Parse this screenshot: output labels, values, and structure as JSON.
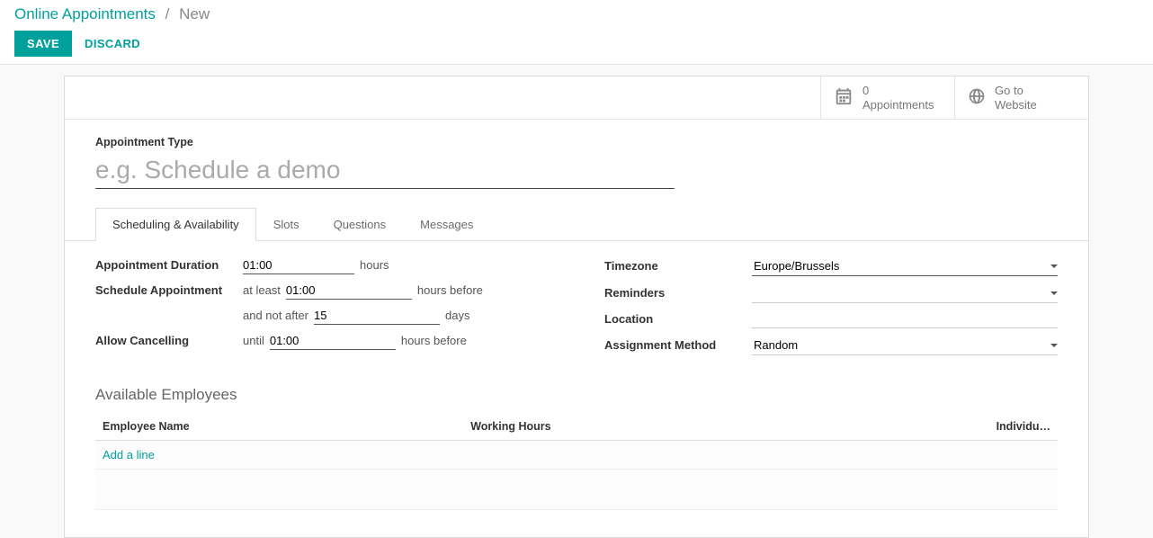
{
  "breadcrumb": {
    "root": "Online Appointments",
    "sep": "/",
    "current": "New"
  },
  "actions": {
    "save": "SAVE",
    "discard": "DISCARD"
  },
  "stat_buttons": {
    "appointments": {
      "count": "0",
      "label": "Appointments"
    },
    "website": {
      "line1": "Go to",
      "line2": "Website"
    }
  },
  "form": {
    "type_label": "Appointment Type",
    "type_value": "",
    "type_placeholder": "e.g. Schedule a demo",
    "tabs": [
      "Scheduling & Availability",
      "Slots",
      "Questions",
      "Messages"
    ],
    "left": {
      "duration_label": "Appointment Duration",
      "duration_value": "01:00",
      "duration_unit": "hours",
      "schedule_label": "Schedule Appointment",
      "schedule_atleast_prefix": "at least",
      "schedule_atleast_value": "01:00",
      "schedule_atleast_unit": "hours before",
      "schedule_notafter_prefix": "and not after",
      "schedule_notafter_value": "15",
      "schedule_notafter_unit": "days",
      "cancel_label": "Allow Cancelling",
      "cancel_prefix": "until",
      "cancel_value": "01:00",
      "cancel_unit": "hours before"
    },
    "right": {
      "timezone_label": "Timezone",
      "timezone_value": "Europe/Brussels",
      "reminders_label": "Reminders",
      "reminders_value": "",
      "location_label": "Location",
      "location_value": "",
      "assignment_label": "Assignment Method",
      "assignment_value": "Random"
    },
    "section_heading": "Available Employees",
    "table": {
      "col_employee": "Employee Name",
      "col_hours": "Working Hours",
      "col_individual": "Individu…",
      "add_line": "Add a line"
    }
  }
}
